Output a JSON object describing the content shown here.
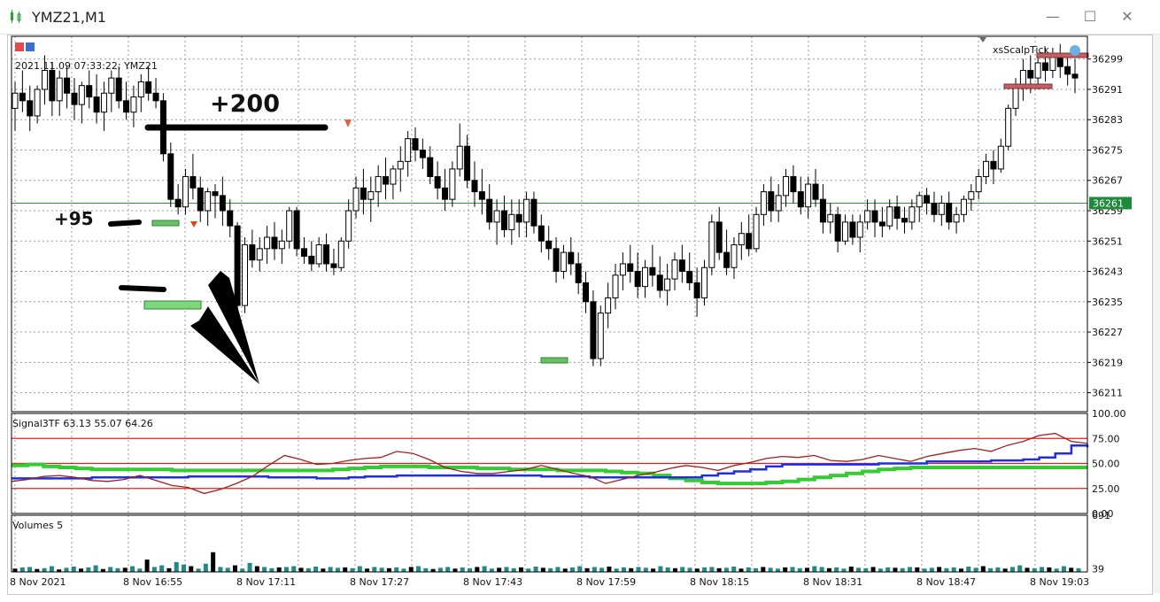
{
  "window": {
    "title": "YMZ21,M1",
    "minimize_icon": "minimize-icon",
    "maximize_icon": "maximize-icon",
    "close_icon": "close-icon"
  },
  "main_panel": {
    "info_line": "2021.11.09 07:33:22; YMZ21",
    "ea_label": "xsScalpTick",
    "price_ticks": [
      "36299",
      "36291",
      "36283",
      "36275",
      "36267",
      "36259",
      "36251",
      "36243",
      "36235",
      "36227",
      "36219",
      "36211"
    ],
    "current_price": "36261",
    "annotations": [
      "+200",
      "+95"
    ]
  },
  "indicator_panel": {
    "label": "Signal3TF 63.13 55.07 64.26",
    "ticks": [
      "100.00",
      "75.00",
      "50.00",
      "25.00",
      "0.00"
    ]
  },
  "volume_panel": {
    "label": "Volumes 5",
    "ticks": [
      "691",
      "39"
    ]
  },
  "time_axis": [
    "8 Nov 2021",
    "8 Nov 16:55",
    "8 Nov 17:11",
    "8 Nov 17:27",
    "8 Nov 17:43",
    "8 Nov 17:59",
    "8 Nov 18:15",
    "8 Nov 18:31",
    "8 Nov 18:47",
    "8 Nov 19:03"
  ],
  "chart_data": [
    {
      "type": "candlestick",
      "title": "YMZ21,M1",
      "ylim": [
        36206,
        36305
      ],
      "current_price": 36261,
      "candles_ohlc": [
        [
          36286,
          36293,
          36280,
          36290
        ],
        [
          36290,
          36296,
          36285,
          36288
        ],
        [
          36288,
          36292,
          36280,
          36284
        ],
        [
          36284,
          36292,
          36282,
          36291
        ],
        [
          36291,
          36300,
          36287,
          36296
        ],
        [
          36296,
          36298,
          36284,
          36288
        ],
        [
          36288,
          36296,
          36284,
          36294
        ],
        [
          36294,
          36297,
          36286,
          36290
        ],
        [
          36290,
          36294,
          36283,
          36287
        ],
        [
          36287,
          36293,
          36282,
          36292
        ],
        [
          36292,
          36296,
          36286,
          36289
        ],
        [
          36289,
          36295,
          36282,
          36285
        ],
        [
          36285,
          36293,
          36280,
          36290
        ],
        [
          36290,
          36296,
          36285,
          36294
        ],
        [
          36294,
          36297,
          36286,
          36288
        ],
        [
          36288,
          36293,
          36283,
          36285
        ],
        [
          36285,
          36292,
          36281,
          36289
        ],
        [
          36289,
          36295,
          36285,
          36293
        ],
        [
          36293,
          36297,
          36288,
          36290
        ],
        [
          36290,
          36294,
          36286,
          36288
        ],
        [
          36288,
          36290,
          36272,
          36274
        ],
        [
          36274,
          36277,
          36260,
          36262
        ],
        [
          36262,
          36266,
          36258,
          36260
        ],
        [
          36260,
          36270,
          36258,
          36268
        ],
        [
          36268,
          36274,
          36262,
          36265
        ],
        [
          36265,
          36268,
          36256,
          36259
        ],
        [
          36259,
          36265,
          36255,
          36264
        ],
        [
          36264,
          36266,
          36257,
          36263
        ],
        [
          36263,
          36268,
          36255,
          36259
        ],
        [
          36259,
          36262,
          36252,
          36255
        ],
        [
          36255,
          36256,
          36232,
          36234
        ],
        [
          36234,
          36252,
          36232,
          36250
        ],
        [
          36250,
          36254,
          36244,
          36246
        ],
        [
          36246,
          36252,
          36243,
          36249
        ],
        [
          36249,
          36255,
          36245,
          36252
        ],
        [
          36252,
          36256,
          36246,
          36249
        ],
        [
          36249,
          36254,
          36245,
          36251
        ],
        [
          36251,
          36260,
          36249,
          36259
        ],
        [
          36259,
          36260,
          36247,
          36249
        ],
        [
          36249,
          36252,
          36245,
          36247
        ],
        [
          36247,
          36251,
          36243,
          36245
        ],
        [
          36245,
          36252,
          36244,
          36250
        ],
        [
          36250,
          36253,
          36243,
          36245
        ],
        [
          36245,
          36249,
          36242,
          36244
        ],
        [
          36244,
          36252,
          36243,
          36251
        ],
        [
          36251,
          36262,
          36249,
          36259
        ],
        [
          36259,
          36268,
          36257,
          36265
        ],
        [
          36265,
          36270,
          36258,
          36262
        ],
        [
          36262,
          36268,
          36256,
          36264
        ],
        [
          36264,
          36271,
          36260,
          36268
        ],
        [
          36268,
          36273,
          36262,
          36266
        ],
        [
          36266,
          36271,
          36262,
          36270
        ],
        [
          36270,
          36276,
          36264,
          36272
        ],
        [
          36272,
          36280,
          36268,
          36278
        ],
        [
          36278,
          36281,
          36272,
          36275
        ],
        [
          36275,
          36278,
          36270,
          36273
        ],
        [
          36273,
          36276,
          36266,
          36268
        ],
        [
          36268,
          36272,
          36262,
          36265
        ],
        [
          36265,
          36270,
          36259,
          36262
        ],
        [
          36262,
          36272,
          36260,
          36270
        ],
        [
          36270,
          36282,
          36268,
          36276
        ],
        [
          36276,
          36279,
          36265,
          36267
        ],
        [
          36267,
          36272,
          36260,
          36264
        ],
        [
          36264,
          36270,
          36258,
          36262
        ],
        [
          36262,
          36266,
          36254,
          36256
        ],
        [
          36256,
          36262,
          36250,
          36259
        ],
        [
          36259,
          36263,
          36252,
          36254
        ],
        [
          36254,
          36262,
          36250,
          36258
        ],
        [
          36258,
          36262,
          36252,
          36256
        ],
        [
          36256,
          36264,
          36252,
          36262
        ],
        [
          36262,
          36264,
          36253,
          36255
        ],
        [
          36255,
          36258,
          36248,
          36251
        ],
        [
          36251,
          36255,
          36246,
          36249
        ],
        [
          36249,
          36252,
          36240,
          36243
        ],
        [
          36243,
          36250,
          36241,
          36248
        ],
        [
          36248,
          36252,
          36242,
          36245
        ],
        [
          36245,
          36248,
          36237,
          36240
        ],
        [
          36240,
          36243,
          36232,
          36235
        ],
        [
          36235,
          36238,
          36218,
          36220
        ],
        [
          36220,
          36234,
          36218,
          36232
        ],
        [
          36232,
          36240,
          36228,
          36236
        ],
        [
          36236,
          36245,
          36233,
          36242
        ],
        [
          36242,
          36248,
          36238,
          36245
        ],
        [
          36245,
          36250,
          36240,
          36243
        ],
        [
          36243,
          36248,
          36236,
          36239
        ],
        [
          36239,
          36246,
          36236,
          36244
        ],
        [
          36244,
          36250,
          36239,
          36242
        ],
        [
          36242,
          36247,
          36236,
          36238
        ],
        [
          36238,
          36245,
          36234,
          36241
        ],
        [
          36241,
          36248,
          36238,
          36246
        ],
        [
          36246,
          36250,
          36240,
          36243
        ],
        [
          36243,
          36248,
          36238,
          36240
        ],
        [
          36240,
          36244,
          36231,
          36236
        ],
        [
          36236,
          36246,
          36234,
          36244
        ],
        [
          36244,
          36258,
          36242,
          36256
        ],
        [
          36256,
          36260,
          36246,
          36248
        ],
        [
          36248,
          36254,
          36242,
          36244
        ],
        [
          36244,
          36252,
          36241,
          36250
        ],
        [
          36250,
          36256,
          36246,
          36253
        ],
        [
          36253,
          36258,
          36247,
          36249
        ],
        [
          36249,
          36260,
          36248,
          36258
        ],
        [
          36258,
          36266,
          36255,
          36264
        ],
        [
          36264,
          36268,
          36256,
          36259
        ],
        [
          36259,
          36266,
          36256,
          36263
        ],
        [
          36263,
          36270,
          36260,
          36268
        ],
        [
          36268,
          36271,
          36261,
          36264
        ],
        [
          36264,
          36268,
          36258,
          36260
        ],
        [
          36260,
          36268,
          36257,
          36266
        ],
        [
          36266,
          36270,
          36260,
          36262
        ],
        [
          36262,
          36266,
          36253,
          36256
        ],
        [
          36256,
          36261,
          36253,
          36258
        ],
        [
          36258,
          36260,
          36248,
          36251
        ],
        [
          36251,
          36258,
          36250,
          36256
        ],
        [
          36256,
          36258,
          36250,
          36252
        ],
        [
          36252,
          36258,
          36248,
          36256
        ],
        [
          36256,
          36262,
          36254,
          36259
        ],
        [
          36259,
          36262,
          36252,
          36256
        ],
        [
          36256,
          36260,
          36252,
          36255
        ],
        [
          36255,
          36262,
          36254,
          36260
        ],
        [
          36260,
          36263,
          36254,
          36257
        ],
        [
          36257,
          36260,
          36253,
          36256
        ],
        [
          36256,
          36262,
          36254,
          36260
        ],
        [
          36260,
          36264,
          36256,
          36263
        ],
        [
          36263,
          36265,
          36258,
          36261
        ],
        [
          36261,
          36264,
          36256,
          36258
        ],
        [
          36258,
          36263,
          36255,
          36261
        ],
        [
          36261,
          36264,
          36254,
          36256
        ],
        [
          36256,
          36260,
          36253,
          36258
        ],
        [
          36258,
          36263,
          36256,
          36262
        ],
        [
          36262,
          36266,
          36259,
          36264
        ],
        [
          36264,
          36270,
          36262,
          36268
        ],
        [
          36268,
          36274,
          36266,
          36272
        ],
        [
          36272,
          36275,
          36266,
          36270
        ],
        [
          36270,
          36278,
          36269,
          36276
        ],
        [
          36276,
          36287,
          36275,
          36286
        ],
        [
          36286,
          36294,
          36284,
          36292
        ],
        [
          36292,
          36299,
          36288,
          36296
        ],
        [
          36296,
          36300,
          36290,
          36294
        ],
        [
          36294,
          36300,
          36291,
          36298
        ],
        [
          36298,
          36302,
          36293,
          36296
        ],
        [
          36296,
          36302,
          36294,
          36300
        ],
        [
          36300,
          36303,
          36294,
          36297
        ],
        [
          36297,
          36300,
          36292,
          36295
        ],
        [
          36295,
          36299,
          36290,
          36294
        ]
      ]
    },
    {
      "type": "line",
      "title": "Signal3TF 63.13 55.07 64.26",
      "ylim": [
        0,
        100
      ],
      "levels": [
        25,
        50,
        75
      ],
      "series": [
        {
          "values": [
            48,
            49,
            47,
            46,
            45,
            44,
            44,
            44,
            44,
            44,
            43,
            43,
            43,
            43,
            43,
            43,
            43,
            43,
            43,
            43,
            44,
            45,
            46,
            47,
            47,
            47,
            46,
            46,
            46,
            45,
            45,
            44,
            44,
            44,
            43,
            43,
            43,
            42,
            41,
            40,
            38,
            35,
            33,
            31,
            30,
            30,
            30,
            31,
            32,
            34,
            36,
            38,
            40,
            42,
            44,
            45,
            46,
            46,
            46,
            46,
            46,
            46,
            46,
            46,
            46,
            46,
            46,
            46
          ]
        },
        {
          "values": [
            35,
            35,
            35,
            35,
            35,
            36,
            36,
            36,
            36,
            36,
            36,
            37,
            37,
            37,
            37,
            37,
            36,
            36,
            36,
            35,
            35,
            36,
            37,
            37,
            38,
            38,
            38,
            38,
            38,
            38,
            38,
            38,
            38,
            37,
            37,
            37,
            36,
            36,
            36,
            36,
            36,
            36,
            36,
            38,
            40,
            42,
            44,
            47,
            49,
            49,
            49,
            49,
            49,
            49,
            50,
            50,
            50,
            52,
            52,
            52,
            52,
            53,
            53,
            54,
            56,
            60,
            68,
            66
          ]
        },
        {
          "values": [
            32,
            34,
            37,
            38,
            36,
            33,
            32,
            34,
            38,
            33,
            28,
            26,
            20,
            24,
            30,
            37,
            48,
            58,
            54,
            49,
            50,
            53,
            55,
            56,
            62,
            60,
            54,
            46,
            42,
            40,
            40,
            42,
            44,
            48,
            44,
            40,
            37,
            30,
            34,
            38,
            41,
            45,
            48,
            46,
            43,
            48,
            51,
            55,
            57,
            56,
            58,
            53,
            52,
            54,
            58,
            55,
            52,
            57,
            60,
            63,
            65,
            62,
            68,
            72,
            78,
            80,
            72,
            70
          ]
        }
      ]
    },
    {
      "type": "bar",
      "title": "Volumes 5",
      "ylim": [
        0,
        691
      ],
      "values": [
        40,
        55,
        60,
        35,
        45,
        70,
        30,
        50,
        65,
        40,
        55,
        80,
        35,
        60,
        45,
        50,
        70,
        40,
        150,
        60,
        80,
        45,
        120,
        90,
        70,
        40,
        100,
        240,
        60,
        50,
        80,
        40,
        110,
        70,
        60,
        45,
        55,
        60,
        70,
        50,
        45,
        65,
        40,
        60,
        50,
        55,
        45,
        70,
        40,
        60,
        50,
        45,
        55,
        40,
        60,
        70,
        45,
        35,
        50,
        60,
        40,
        55,
        45,
        60,
        70,
        40,
        50,
        60,
        45,
        55,
        40,
        65,
        50,
        45,
        60,
        40,
        55,
        70,
        45,
        60,
        50,
        65,
        40,
        55,
        45,
        60,
        50,
        40,
        70,
        55,
        45,
        60,
        50,
        40,
        55,
        60,
        45,
        50,
        65,
        40,
        55,
        45,
        60,
        50,
        40,
        55,
        60,
        45,
        50,
        70,
        60,
        45,
        55,
        40,
        65,
        50,
        45,
        60,
        40,
        55,
        50,
        45,
        60,
        55,
        40,
        50,
        60,
        45,
        55,
        40,
        65,
        50,
        70,
        45,
        55,
        40,
        60,
        80,
        50,
        45,
        60,
        55,
        40,
        70,
        50,
        45
      ]
    }
  ]
}
